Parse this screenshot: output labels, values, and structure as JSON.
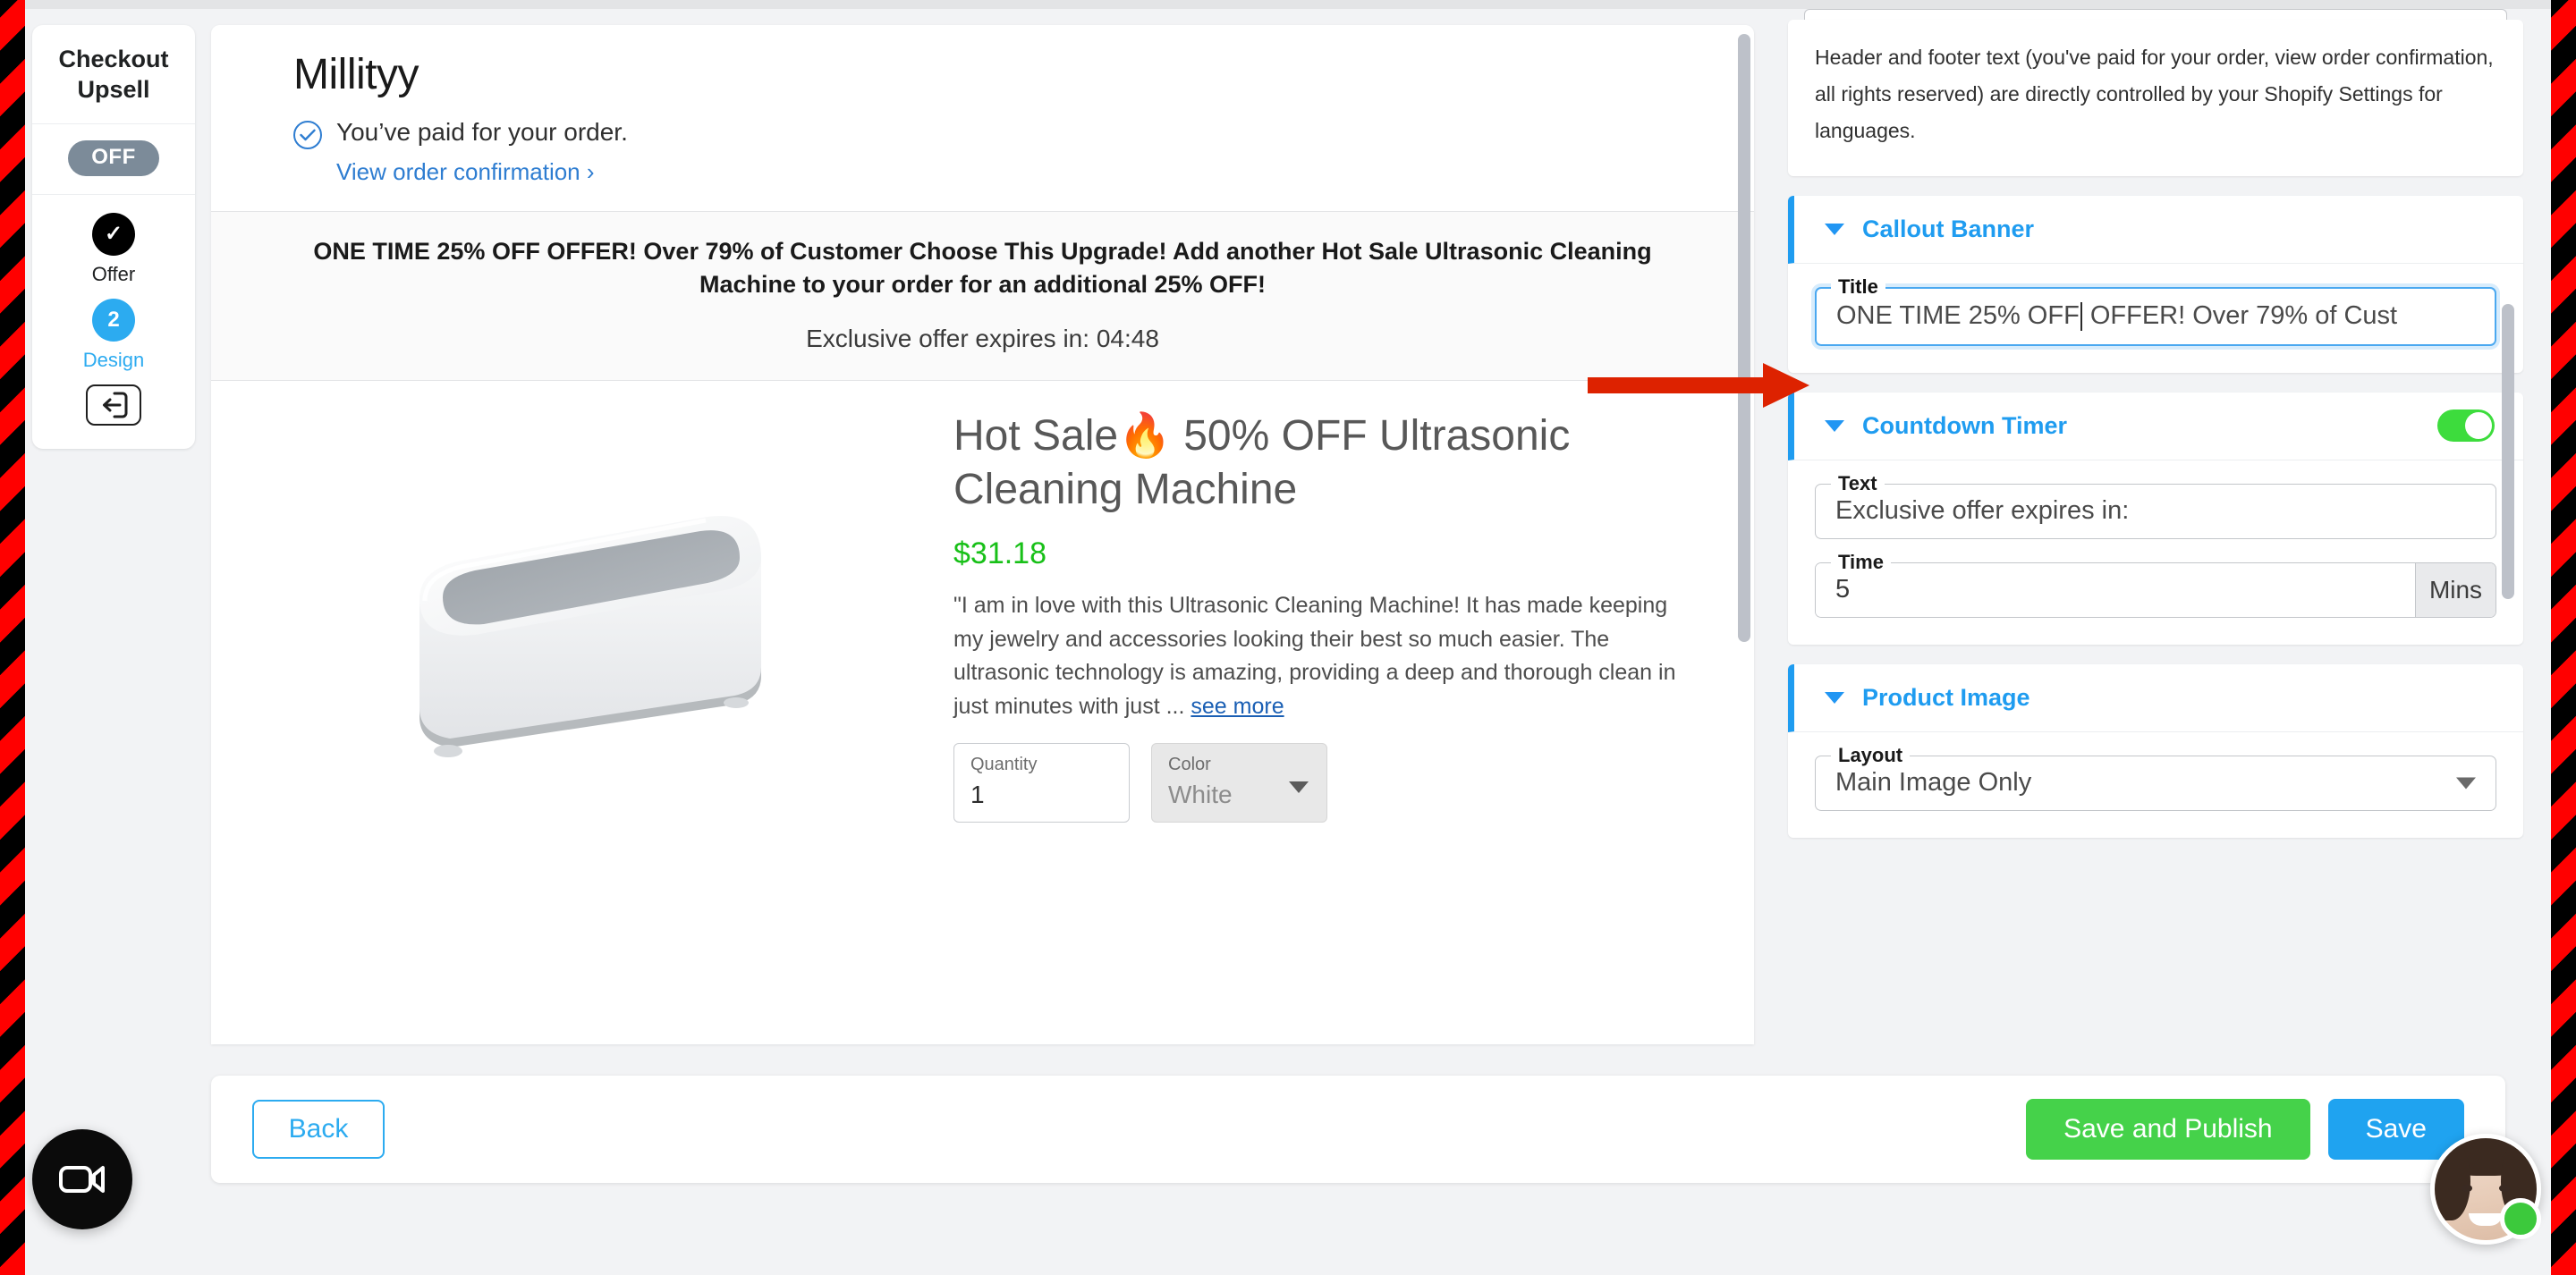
{
  "sidebar": {
    "title": "Checkout Upsell",
    "status_pill": "OFF",
    "steps": [
      {
        "label": "Offer",
        "badge": "✓",
        "state": "done"
      },
      {
        "label": "Design",
        "badge": "2",
        "state": "active"
      }
    ],
    "logout_icon": "logout-icon"
  },
  "preview": {
    "shop_name": "Millityy",
    "paid_text": "You’ve paid for your order.",
    "view_confirmation_link": "View order confirmation ›",
    "callout_title": "ONE TIME 25% OFF OFFER! Over 79% of Customer Choose This Upgrade! Add another Hot Sale Ultrasonic Cleaning Machine to your order for an additional 25% OFF!",
    "countdown_label": "Exclusive offer expires in:",
    "countdown_value": "04:48",
    "product": {
      "title": "Hot Sale🔥 50% OFF Ultrasonic Cleaning Machine",
      "price": "$31.18",
      "description": "\"I am in love with this Ultrasonic Cleaning Machine! It has made keeping my jewelry and accessories looking their best so much easier. The ultrasonic technology is amazing, providing a deep and thorough clean in just minutes with just ...",
      "see_more": "see more",
      "quantity_label": "Quantity",
      "quantity_value": "1",
      "color_label": "Color",
      "color_value": "White"
    }
  },
  "settings": {
    "note": "Header and footer text (you've paid for your order, view order confirmation, all rights reserved) are directly controlled by your Shopify Settings for languages.",
    "callout_banner": {
      "title": "Callout Banner",
      "title_field_label": "Title",
      "title_field_value": "ONE TIME 25% OFF OFFER! Over 79% of Cust"
    },
    "countdown_timer": {
      "title": "Countdown Timer",
      "enabled": true,
      "text_label": "Text",
      "text_value": "Exclusive offer expires in:",
      "time_label": "Time",
      "time_value": "5",
      "time_unit": "Mins"
    },
    "product_image": {
      "title": "Product Image",
      "layout_label": "Layout",
      "layout_value": "Main Image Only"
    }
  },
  "actions": {
    "back": "Back",
    "save_and_publish": "Save and Publish",
    "save": "Save"
  },
  "widgets": {
    "video_fab_icon": "video-camera-icon",
    "chat_avatar": "support-agent-avatar",
    "chat_status": "online-status-dot"
  },
  "colors": {
    "accent_blue": "#1f9cf0",
    "green": "#45d24a",
    "price_green": "#18c018",
    "arrow_red": "#dd2200",
    "toggle_on": "#3ddc3d"
  }
}
